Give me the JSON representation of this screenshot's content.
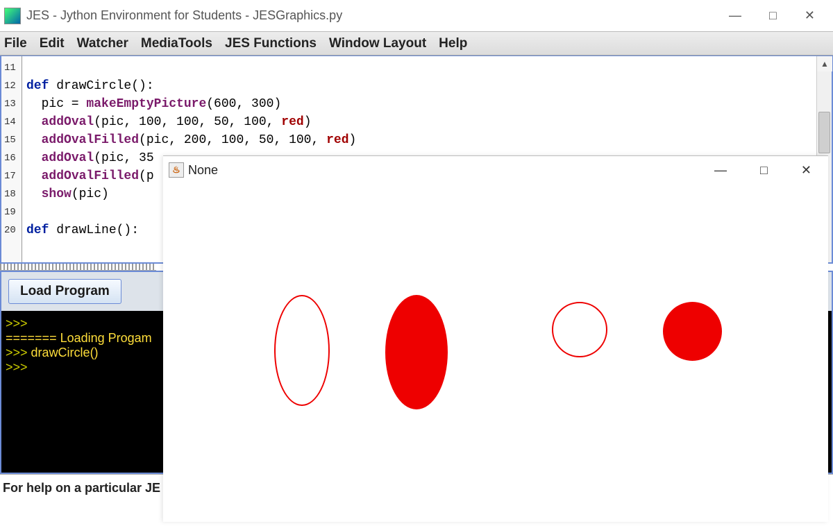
{
  "window": {
    "title": "JES - Jython Environment for Students - JESGraphics.py",
    "min": "—",
    "max": "□",
    "close": "✕"
  },
  "menu": {
    "file": "File",
    "edit": "Edit",
    "watcher": "Watcher",
    "mediatools": "MediaTools",
    "jes": "JES Functions",
    "layout": "Window Layout",
    "help": "Help"
  },
  "gutter": [
    "11",
    "12",
    "13",
    "14",
    "15",
    "16",
    "17",
    "18",
    "19",
    "20"
  ],
  "code": {
    "l12_kw": "def",
    "l12_rest": " drawCircle():",
    "l13a": "  pic = ",
    "l13_fn": "makeEmptyPicture",
    "l13b": "(600, 300)",
    "l14_fn": "addOval",
    "l14_args": "(pic, 100, 100, 50, 100, ",
    "l14_red": "red",
    "l14_close": ")",
    "l15_fn": "addOvalFilled",
    "l15_args": "(pic, 200, 100, 50, 100, ",
    "l15_red": "red",
    "l15_close": ")",
    "l16_fn": "addOval",
    "l16_args": "(pic, 35",
    "l17_fn": "addOvalFilled",
    "l17_args": "(p",
    "l18_fn": "show",
    "l18_args": "(pic)",
    "l20_kw": "def",
    "l20_rest": " drawLine():"
  },
  "load_button": "Load Program",
  "console": {
    "p1": ">>> ",
    "loading": "======= Loading Progam",
    "p2": ">>> ",
    "cmd": "drawCircle()",
    "p3": ">>> "
  },
  "status": "For help on a particular JE",
  "popup": {
    "title": "None",
    "min": "—",
    "max": "□",
    "close": "✕"
  }
}
